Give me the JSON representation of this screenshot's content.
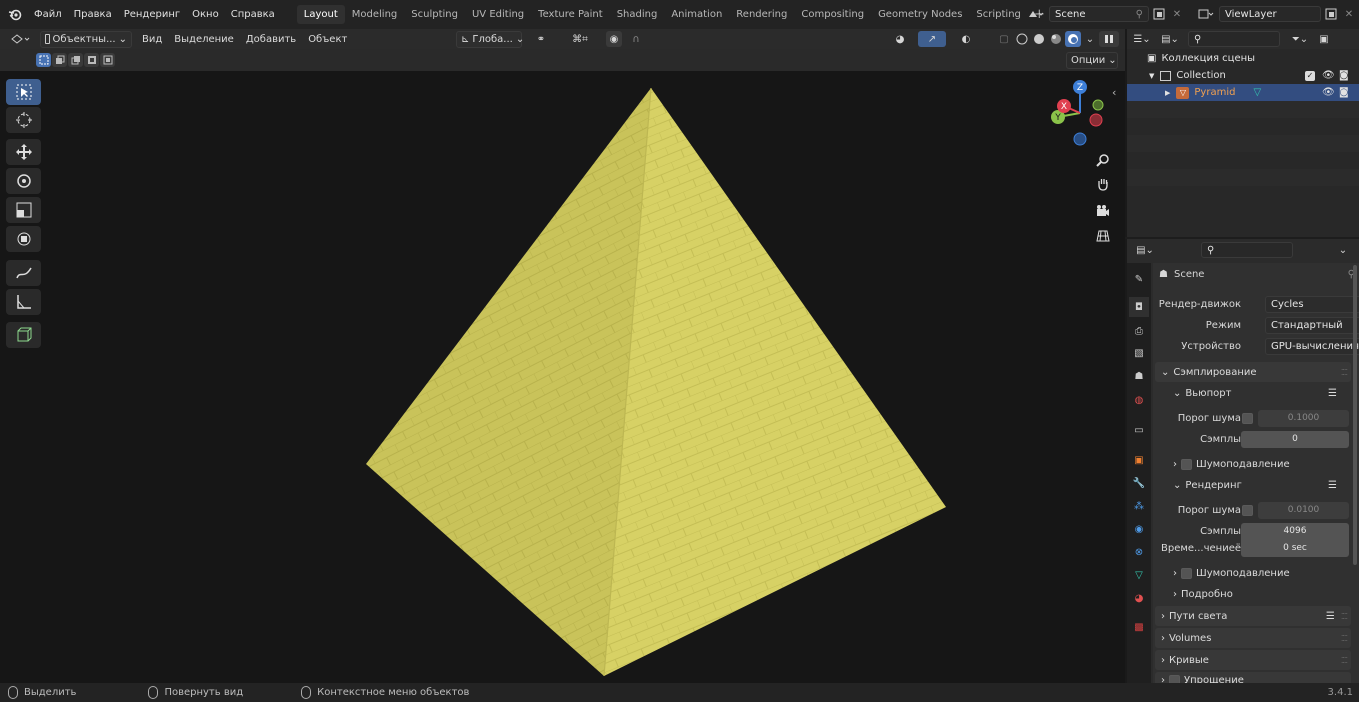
{
  "menu": {
    "file": "Файл",
    "edit": "Правка",
    "render": "Рендеринг",
    "window": "Окно",
    "help": "Справка"
  },
  "workspaces": [
    "Layout",
    "Modeling",
    "Sculpting",
    "UV Editing",
    "Texture Paint",
    "Shading",
    "Animation",
    "Rendering",
    "Compositing",
    "Geometry Nodes",
    "Scripting"
  ],
  "workspace_active": "Layout",
  "scene": {
    "name": "Scene"
  },
  "view_layer": {
    "name": "ViewLayer"
  },
  "header": {
    "mode": "Объектны...",
    "view": "Вид",
    "select": "Выделение",
    "add": "Добавить",
    "object": "Объект",
    "transform": "Глоба...",
    "options": "Опции"
  },
  "outliner": {
    "scene_collection": "Коллекция сцены",
    "collection": "Collection",
    "object": "Pyramid"
  },
  "properties": {
    "scene_label": "Scene",
    "render_engine_label": "Рендер-движок",
    "render_engine": "Cycles",
    "mode_label": "Режим",
    "mode": "Стандартный",
    "device_label": "Устройство",
    "device": "GPU-вычисления",
    "sampling": "Сэмплирование",
    "viewport": "Вьюпорт",
    "noise_threshold_label": "Порог шума",
    "viewport_noise_threshold": "0.1000",
    "samples_label": "Сэмплы",
    "viewport_samples": "0",
    "denoise": "Шумоподавление",
    "render": "Рендеринг",
    "render_noise_threshold": "0.0100",
    "render_samples": "4096",
    "time_limit_label": "Време...чениеё",
    "time_limit": "0 sec",
    "advanced": "Подробно",
    "light_paths": "Пути света",
    "volumes": "Volumes",
    "curves": "Кривые",
    "simplify": "Упрощение"
  },
  "status": {
    "select": "Выделить",
    "rotate": "Повернуть вид",
    "context": "Контекстное меню объектов",
    "version": "3.4.1"
  },
  "gizmo": {
    "x": "X",
    "y": "Y",
    "z": "Z"
  },
  "colors": {
    "accent": "#4772b3",
    "pyramid": "#d6d060",
    "x_axis": "#e04050",
    "y_axis": "#8bc34a",
    "z_axis": "#3d7fd8"
  }
}
